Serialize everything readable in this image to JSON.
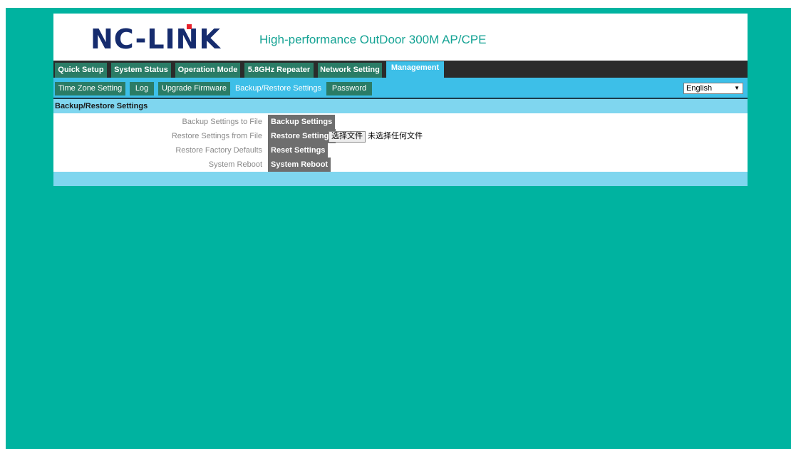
{
  "brand": {
    "logo_text": "NC-LINK",
    "tagline": "High-performance OutDoor 300M AP/CPE"
  },
  "main_nav": [
    {
      "label": "Quick Setup",
      "active": false
    },
    {
      "label": "System Status",
      "active": false
    },
    {
      "label": "Operation Mode",
      "active": false
    },
    {
      "label": "5.8GHz Repeater",
      "active": false
    },
    {
      "label": "Network Setting",
      "active": false
    },
    {
      "label": "Management",
      "active": true
    }
  ],
  "sub_nav": [
    {
      "label": "Time Zone Setting",
      "active": false
    },
    {
      "label": "Log",
      "active": false
    },
    {
      "label": "Upgrade Firmware",
      "active": false
    },
    {
      "label": "Backup/Restore Settings",
      "active": true
    },
    {
      "label": "Password",
      "active": false
    }
  ],
  "language": {
    "selected": "English"
  },
  "section": {
    "title": "Backup/Restore Settings"
  },
  "rows": [
    {
      "label": "Backup Settings to File",
      "button": "Backup Settings"
    },
    {
      "label": "Restore Settings from File",
      "button": "Restore Settings",
      "file_button": "选择文件",
      "file_status": "未选择任何文件"
    },
    {
      "label": "Restore Factory Defaults",
      "button": "Reset Settings"
    },
    {
      "label": "System Reboot",
      "button": "System Reboot"
    }
  ],
  "colors": {
    "page_bg": "#00b3a0",
    "tab_bg": "#2a7c66",
    "active_tab_bg": "#3dbfe8",
    "section_bar": "#7fd6ef",
    "button_bg": "#6e6e6e",
    "logo_navy": "#162c6e",
    "logo_red_dot": "#e8212b"
  }
}
